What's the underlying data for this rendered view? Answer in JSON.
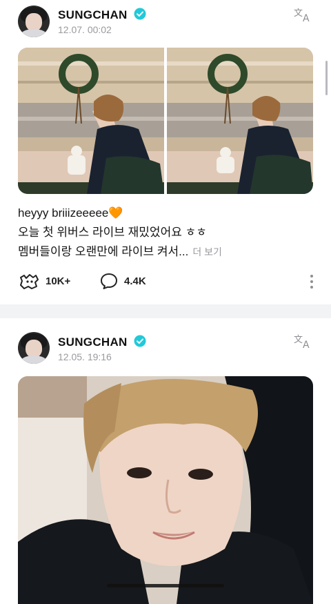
{
  "feed": {
    "posts": [
      {
        "author": "SUNGCHAN",
        "time": "12.07. 00:02",
        "text_line1": "heyyy briiizeeeee🧡",
        "text_line2": "오늘 첫 위버스 라이브 재밌었어요 ㅎㅎ",
        "text_line3": "멤버들이랑 오랜만에 라이브 켜서...",
        "more_label": "더 보기",
        "reaction_count": "10K+",
        "comment_count": "4.4K"
      },
      {
        "author": "SUNGCHAN",
        "time": "12.05. 19:16"
      }
    ]
  },
  "colors": {
    "verified": "#22c9d8",
    "heart": "#f08a24",
    "muted": "#9a9aa0",
    "divider": "#f2f3f5"
  },
  "icons": {
    "verified": "verified-badge-icon",
    "translate": "translate-icon",
    "reaction": "weverse-reaction-icon",
    "comment": "comment-bubble-icon",
    "more": "kebab-menu-icon"
  }
}
